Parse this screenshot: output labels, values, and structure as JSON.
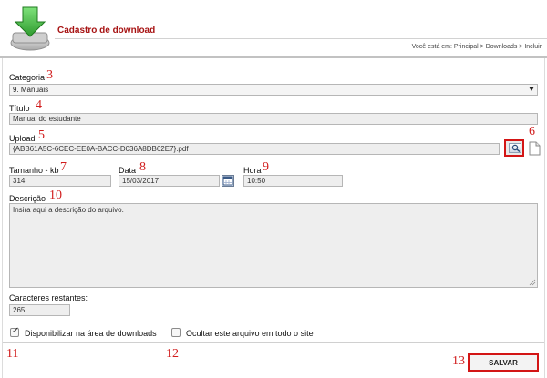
{
  "header": {
    "title": "Cadastro de download",
    "breadcrumb": "Você está em: Principal > Downloads > Incluir"
  },
  "form": {
    "categoria": {
      "label": "Categoria",
      "value": "9. Manuais"
    },
    "titulo": {
      "label": "Título",
      "value": "Manual do estudante"
    },
    "upload": {
      "label": "Upload",
      "value": "{ABB61A5C-6CEC-EE0A-BACC-D036A8DB62E7}.pdf"
    },
    "tamanho": {
      "label": "Tamanho - kb",
      "value": "314"
    },
    "data": {
      "label": "Data",
      "value": "15/03/2017"
    },
    "hora": {
      "label": "Hora",
      "value": "10:50"
    },
    "descricao": {
      "label": "Descrição",
      "value": "Insira aqui a descrição do arquivo."
    },
    "caracteres": {
      "label": "Caracteres restantes:",
      "value": "265"
    },
    "disponibilizar": {
      "label": "Disponibilizar na área de downloads",
      "checked": true
    },
    "ocultar": {
      "label": "Ocultar este arquivo em todo o site",
      "checked": false
    },
    "save_label": "SALVAR"
  },
  "annotations": [
    "3",
    "4",
    "5",
    "6",
    "7",
    "8",
    "9",
    "10",
    "11",
    "12",
    "13"
  ],
  "colors": {
    "title": "#a71313",
    "highlight": "#d31515",
    "annotation": "#d11c1c",
    "field_bg": "#eeeeee"
  },
  "icons": {
    "logo": "download-arrow-drive-icon",
    "upload": "search-icon",
    "file": "file-icon",
    "calendar": "calendar-icon"
  }
}
